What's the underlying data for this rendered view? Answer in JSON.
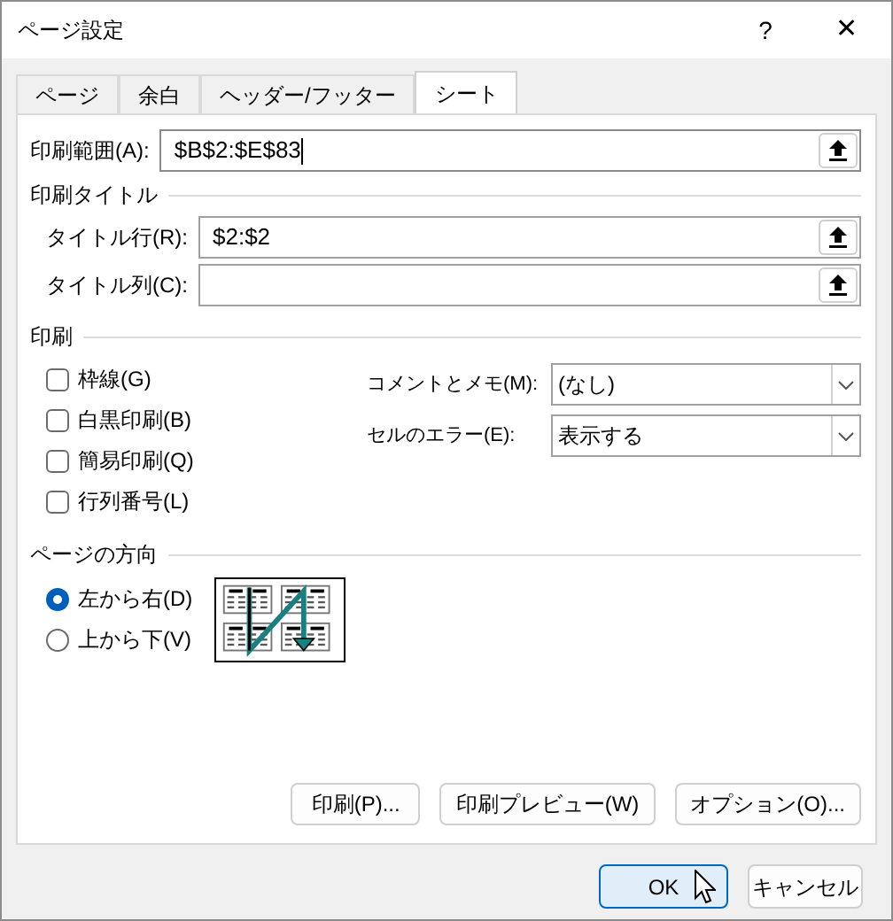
{
  "window": {
    "title": "ページ設定",
    "help": "?",
    "close": "✕"
  },
  "tabs": [
    {
      "label": "ページ",
      "selected": false
    },
    {
      "label": "余白",
      "selected": false
    },
    {
      "label": "ヘッダー/フッター",
      "selected": false
    },
    {
      "label": "シート",
      "selected": true
    }
  ],
  "print_area": {
    "label": "印刷範囲(A):",
    "value": "$B$2:$E$83",
    "focused": true
  },
  "print_titles": {
    "heading": "印刷タイトル",
    "fields": [
      {
        "label": "タイトル行(R):",
        "value": "$2:$2"
      },
      {
        "label": "タイトル列(C):"
      }
    ]
  },
  "print": {
    "heading": "印刷",
    "options": [
      {
        "label": "枠線(G)",
        "checked": false
      },
      {
        "label": "白黒印刷(B)",
        "checked": false
      },
      {
        "label": "簡易印刷(Q)",
        "checked": false
      },
      {
        "label": "行列番号(L)",
        "checked": false
      }
    ],
    "dropdowns": [
      {
        "label": "コメントとメモ(M):",
        "value": "(なし)"
      },
      {
        "label": "セルのエラー(E):",
        "value": "表示する"
      }
    ]
  },
  "page_order": {
    "heading": "ページの方向",
    "options": [
      {
        "label": "左から右(D)",
        "selected": true
      },
      {
        "label": "上から下(V)",
        "selected": false
      }
    ]
  },
  "panel_buttons": [
    "印刷(P)...",
    "印刷プレビュー(W)",
    "オプション(O)..."
  ],
  "dialog_buttons": [
    {
      "label": "OK",
      "default": true
    },
    {
      "label": "キャンセル",
      "default": false
    }
  ]
}
